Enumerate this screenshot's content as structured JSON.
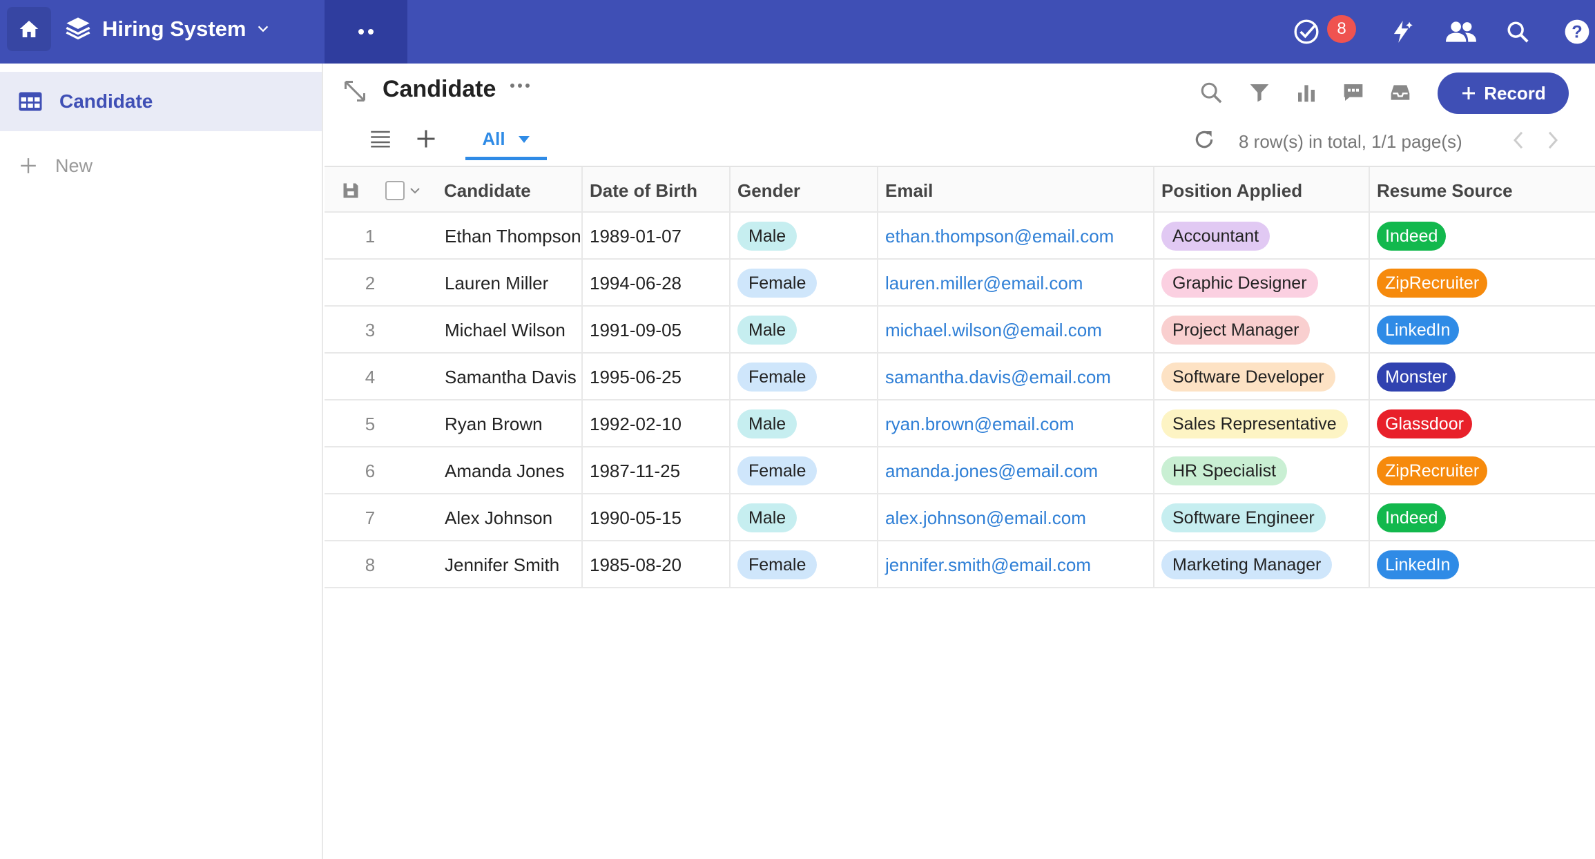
{
  "header": {
    "app_title": "Hiring System",
    "notification_count": "8"
  },
  "sidebar": {
    "items": [
      {
        "label": "Candidate"
      }
    ],
    "new_label": "New"
  },
  "main": {
    "title": "Candidate",
    "record_button": "Record",
    "view_tab": "All",
    "row_info": "8 row(s) in total, 1/1 page(s)"
  },
  "table": {
    "columns": [
      "Candidate",
      "Date of Birth",
      "Gender",
      "Email",
      "Position Applied",
      "Resume Source"
    ],
    "rows": [
      {
        "num": "1",
        "candidate": "Ethan Thompson",
        "dob": "1989-01-07",
        "gender": "Male",
        "email": "ethan.thompson@email.com",
        "position": "Accountant",
        "source": "Indeed"
      },
      {
        "num": "2",
        "candidate": "Lauren Miller",
        "dob": "1994-06-28",
        "gender": "Female",
        "email": "lauren.miller@email.com",
        "position": "Graphic Designer",
        "source": "ZipRecruiter"
      },
      {
        "num": "3",
        "candidate": "Michael Wilson",
        "dob": "1991-09-05",
        "gender": "Male",
        "email": "michael.wilson@email.com",
        "position": "Project Manager",
        "source": "LinkedIn"
      },
      {
        "num": "4",
        "candidate": "Samantha Davis",
        "dob": "1995-06-25",
        "gender": "Female",
        "email": "samantha.davis@email.com",
        "position": "Software Developer",
        "source": "Monster"
      },
      {
        "num": "5",
        "candidate": "Ryan Brown",
        "dob": "1992-02-10",
        "gender": "Male",
        "email": "ryan.brown@email.com",
        "position": "Sales Representative",
        "source": "Glassdoor"
      },
      {
        "num": "6",
        "candidate": "Amanda Jones",
        "dob": "1987-11-25",
        "gender": "Female",
        "email": "amanda.jones@email.com",
        "position": "HR Specialist",
        "source": "ZipRecruiter"
      },
      {
        "num": "7",
        "candidate": "Alex Johnson",
        "dob": "1990-05-15",
        "gender": "Male",
        "email": "alex.johnson@email.com",
        "position": "Software Engineer",
        "source": "Indeed"
      },
      {
        "num": "8",
        "candidate": "Jennifer Smith",
        "dob": "1985-08-20",
        "gender": "Female",
        "email": "jennifer.smith@email.com",
        "position": "Marketing Manager",
        "source": "LinkedIn"
      }
    ]
  },
  "colors": {
    "brand": "#3f4fb5",
    "position_tags": {
      "Accountant": "#e1c9f3",
      "Graphic Designer": "#fbd0e1",
      "Project Manager": "#f9cfcf",
      "Software Developer": "#fde2c4",
      "Sales Representative": "#fdf4c4",
      "HR Specialist": "#c9efd3",
      "Software Engineer": "#c6eef0",
      "Marketing Manager": "#cfe6fb"
    },
    "source_tags": {
      "Indeed": "#12b84d",
      "ZipRecruiter": "#f68a0c",
      "LinkedIn": "#2f8be6",
      "Monster": "#3042b0",
      "Glassdoor": "#e8202a"
    }
  }
}
